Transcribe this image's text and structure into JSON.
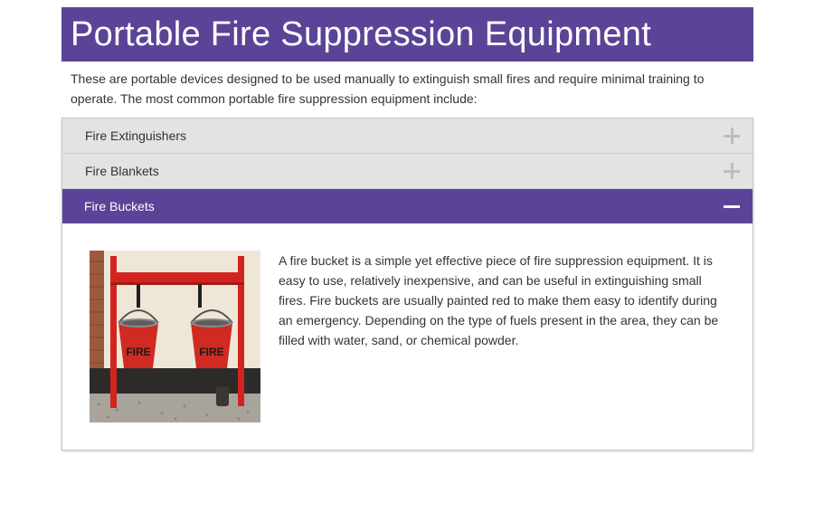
{
  "page": {
    "title": "Portable Fire Suppression Equipment",
    "intro": "These are portable devices designed to be used manually to extinguish small fires and require minimal training to operate. The most common portable fire suppression equipment include:"
  },
  "accordion": {
    "items": [
      {
        "label": "Fire Extinguishers",
        "expanded": false,
        "icon": "plus-icon"
      },
      {
        "label": "Fire Blankets",
        "expanded": false,
        "icon": "plus-icon"
      },
      {
        "label": "Fire Buckets",
        "expanded": true,
        "icon": "minus-icon"
      }
    ],
    "expanded_content": {
      "image_desc": "two red fire buckets hanging on a red wooden rack against a cream wall",
      "text": "A fire bucket is a simple yet effective piece of fire suppression equipment. It is easy to use, relatively inexpensive, and can be useful in extinguishing small fires. Fire buckets are usually painted red to make them easy to identify during an emergency. Depending on the type of fuels present in the area, they can be filled with water, sand, or chemical powder.",
      "bucket_lettering": "FIRE"
    }
  },
  "colors": {
    "accent": "#5b4397",
    "header_bg": "#e3e3e3",
    "text": "#333333"
  }
}
